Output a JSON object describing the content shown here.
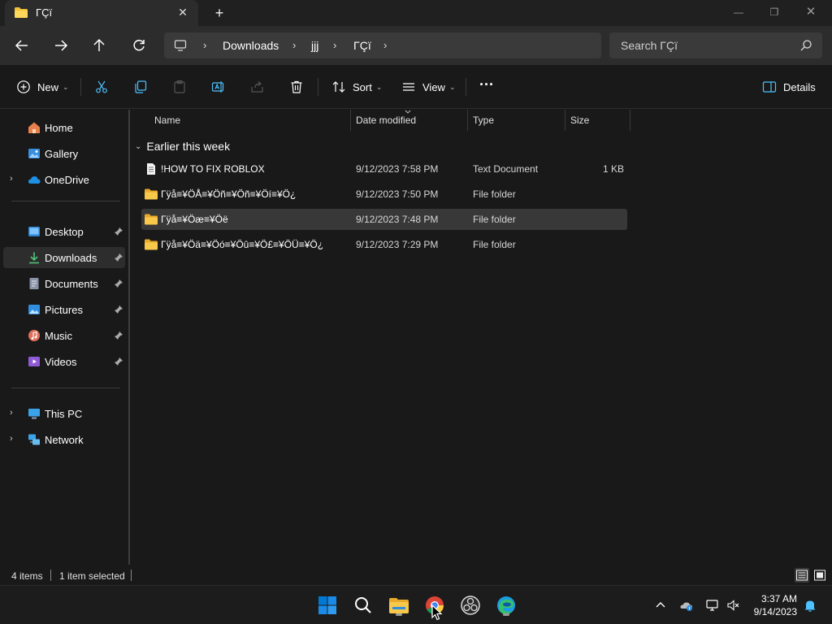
{
  "window": {
    "tab_title": "ΓÇï",
    "tab_close": "✕",
    "new_tab": "+",
    "minimize": "—",
    "maximize": "❐",
    "close": "✕"
  },
  "address": {
    "crumbs": [
      "Downloads",
      "jjj",
      "ΓÇï"
    ],
    "chevron": "›",
    "search_placeholder": "Search ΓÇï"
  },
  "commands": {
    "new_label": "New",
    "sort_label": "Sort",
    "view_label": "View",
    "more_label": "···",
    "details_label": "Details",
    "dropdown": "⌄"
  },
  "sidebar": {
    "items": [
      {
        "label": "Home"
      },
      {
        "label": "Gallery"
      },
      {
        "label": "OneDrive"
      },
      {
        "label": "Desktop"
      },
      {
        "label": "Downloads"
      },
      {
        "label": "Documents"
      },
      {
        "label": "Pictures"
      },
      {
        "label": "Music"
      },
      {
        "label": "Videos"
      },
      {
        "label": "This PC"
      },
      {
        "label": "Network"
      }
    ],
    "expand_glyph": "›"
  },
  "columns": {
    "name": "Name",
    "date": "Date modified",
    "type": "Type",
    "size": "Size"
  },
  "group": {
    "title": "Earlier this week",
    "chevron": "⌄"
  },
  "files": [
    {
      "name": "!HOW TO FIX ROBLOX",
      "date": "9/12/2023 7:58 PM",
      "type": "Text Document",
      "size": "1 KB"
    },
    {
      "name": "Γÿå≡¥ÖÅ≡¥Öñ≡¥Öñ≡¥Öí≡¥Ö¿",
      "date": "9/12/2023 7:50 PM",
      "type": "File folder",
      "size": ""
    },
    {
      "name": "Γÿå≡¥Öæ≡¥Öë",
      "date": "9/12/2023 7:48 PM",
      "type": "File folder",
      "size": ""
    },
    {
      "name": "Γÿå≡¥Öä≡¥Öó≡¥Öû≡¥Ö£≡¥ÖÜ≡¥Ö¿",
      "date": "9/12/2023 7:29 PM",
      "type": "File folder",
      "size": ""
    }
  ],
  "status": {
    "count": "4 items",
    "selection": "1 item selected"
  },
  "clock": {
    "time": "3:37 AM",
    "date": "9/14/2023"
  },
  "colors": {
    "folder": "#f3c13a",
    "accent": "#4cc2ff",
    "windows_blue": "#0078d4"
  }
}
